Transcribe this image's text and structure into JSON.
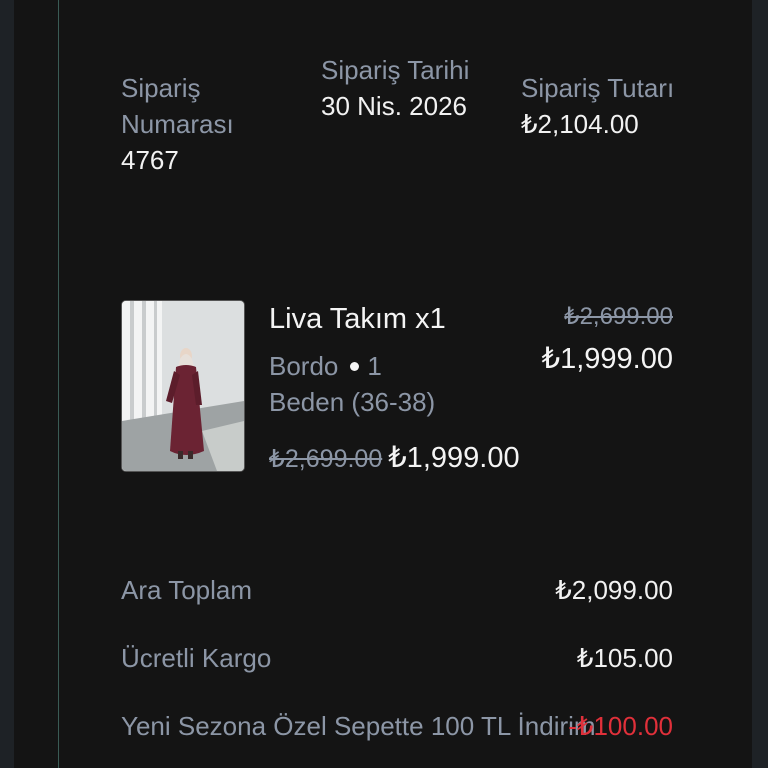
{
  "order_summary": {
    "order_number": {
      "label": "Sipariş Numarası",
      "value": "4767"
    },
    "order_date": {
      "label": "Sipariş Tarihi",
      "value": "30 Nis. 2026"
    },
    "order_total": {
      "label": "Sipariş Tutarı",
      "value": "₺2,104.00"
    }
  },
  "product": {
    "image_icon": "product-photo",
    "title": "Liva Takım x1",
    "color": "Bordo",
    "size_line_1": "1",
    "size_line_2": "Beden (36-38)",
    "original_price": "₺2,699.00",
    "sale_price": "₺1,999.00",
    "row_original_price": "₺2,699.00",
    "row_sale_price": "₺1,999.00"
  },
  "totals": {
    "subtotal": {
      "label": "Ara Toplam",
      "value": "₺2,099.00"
    },
    "shipping": {
      "label": "Ücretli Kargo",
      "value": "₺105.00"
    },
    "discount": {
      "label": "Yeni Sezona Özel Sepette 100 TL İndirim",
      "value": "-₺100.00"
    }
  },
  "colors": {
    "background": "#141414",
    "label_gray": "#8c96a6",
    "text_white": "#f2f2f2",
    "discount_red": "#e0303a",
    "accent_rule": "#3a5b55"
  }
}
